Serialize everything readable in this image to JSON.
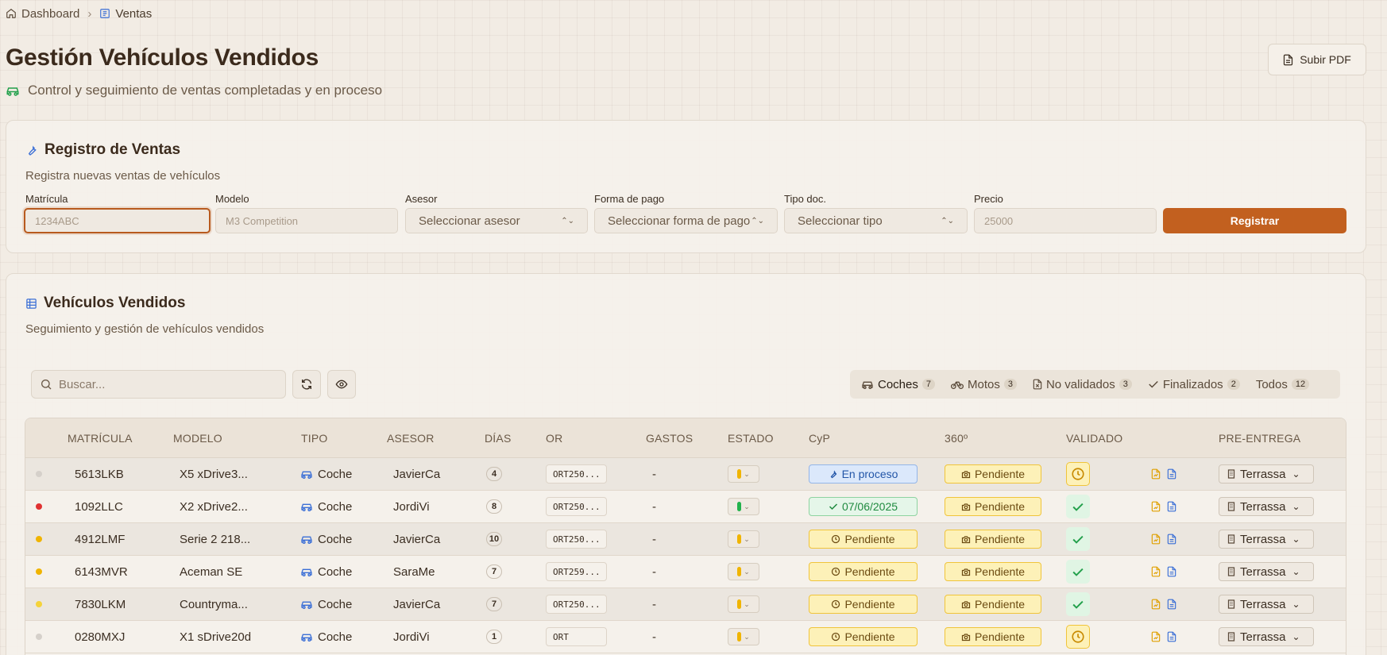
{
  "breadcrumb": {
    "home": "Dashboard",
    "current": "Ventas"
  },
  "header": {
    "title": "Gestión Vehículos Vendidos",
    "subtitle": "Control y seguimiento de ventas completadas y en proceso",
    "upload_pdf_label": "Subir PDF"
  },
  "register": {
    "title": "Registro de Ventas",
    "description": "Registra nuevas ventas de vehículos",
    "fields": {
      "matricula": {
        "label": "Matrícula",
        "placeholder": "1234ABC"
      },
      "modelo": {
        "label": "Modelo",
        "placeholder": "M3 Competition"
      },
      "asesor": {
        "label": "Asesor",
        "value": "Seleccionar asesor"
      },
      "forma_pago": {
        "label": "Forma de pago",
        "value": "Seleccionar forma de pago"
      },
      "tipo_doc": {
        "label": "Tipo doc.",
        "value": "Seleccionar tipo"
      },
      "precio": {
        "label": "Precio",
        "placeholder": "25000"
      }
    },
    "submit_label": "Registrar"
  },
  "sold": {
    "title": "Vehículos Vendidos",
    "description": "Seguimiento y gestión de vehículos vendidos",
    "search_placeholder": "Buscar...",
    "filters": [
      {
        "label": "Coches",
        "count": "7",
        "icon": "car-icon"
      },
      {
        "label": "Motos",
        "count": "3",
        "icon": "bike-icon"
      },
      {
        "label": "No validados",
        "count": "3",
        "icon": "document-x-icon"
      },
      {
        "label": "Finalizados",
        "count": "2",
        "icon": "check-icon"
      },
      {
        "label": "Todos",
        "count": "12",
        "icon": ""
      }
    ],
    "columns": [
      "MATRÍCULA",
      "MODELO",
      "TIPO",
      "ASESOR",
      "DÍAS",
      "OR",
      "GASTOS",
      "ESTADO",
      "CyP",
      "360º",
      "VALIDADO",
      "PRE-ENTREGA"
    ],
    "rows": [
      {
        "dot": "#d5d0ca",
        "matricula": "5613LKB",
        "modelo": "X5 xDrive3...",
        "tipo": "Coche",
        "asesor": "JavierCa",
        "dias": "4",
        "or": "ORT250...",
        "gastos": "-",
        "estado_color": "#f0b400",
        "cyp": {
          "style": "blue",
          "text": "En proceso"
        },
        "p360": "Pendiente",
        "validado": "pending",
        "pre": "Terrassa"
      },
      {
        "dot": "#e03131",
        "matricula": "1092LLC",
        "modelo": "X2 xDrive2...",
        "tipo": "Coche",
        "asesor": "JordiVi",
        "dias": "8",
        "or": "ORT250...",
        "gastos": "-",
        "estado_color": "#22b24c",
        "cyp": {
          "style": "green",
          "text": "07/06/2025"
        },
        "p360": "Pendiente",
        "validado": "ok",
        "pre": "Terrassa"
      },
      {
        "dot": "#f0b400",
        "matricula": "4912LMF",
        "modelo": "Serie 2 218...",
        "tipo": "Coche",
        "asesor": "JavierCa",
        "dias": "10",
        "or": "ORT250...",
        "gastos": "-",
        "estado_color": "#f0b400",
        "cyp": {
          "style": "yel",
          "text": "Pendiente"
        },
        "p360": "Pendiente",
        "validado": "ok",
        "pre": "Terrassa"
      },
      {
        "dot": "#f0b400",
        "matricula": "6143MVR",
        "modelo": "Aceman SE",
        "tipo": "Coche",
        "asesor": "SaraMe",
        "dias": "7",
        "or": "ORT259...",
        "gastos": "-",
        "estado_color": "#f0b400",
        "cyp": {
          "style": "yel",
          "text": "Pendiente"
        },
        "p360": "Pendiente",
        "validado": "ok",
        "pre": "Terrassa"
      },
      {
        "dot": "#f5d33a",
        "matricula": "7830LKM",
        "modelo": "Countryma...",
        "tipo": "Coche",
        "asesor": "JavierCa",
        "dias": "7",
        "or": "ORT250...",
        "gastos": "-",
        "estado_color": "#f0b400",
        "cyp": {
          "style": "yel",
          "text": "Pendiente"
        },
        "p360": "Pendiente",
        "validado": "ok",
        "pre": "Terrassa"
      },
      {
        "dot": "#d5d0ca",
        "matricula": "0280MXJ",
        "modelo": "X1 sDrive20d",
        "tipo": "Coche",
        "asesor": "JordiVi",
        "dias": "1",
        "or": "ORT",
        "gastos": "-",
        "estado_color": "#f0b400",
        "cyp": {
          "style": "yel",
          "text": "Pendiente"
        },
        "p360": "Pendiente",
        "validado": "pending",
        "pre": "Terrassa"
      }
    ]
  },
  "colors": {
    "accent": "#c2601f",
    "car_icon": "#22a04b",
    "link_blue": "#3b6fd6"
  }
}
